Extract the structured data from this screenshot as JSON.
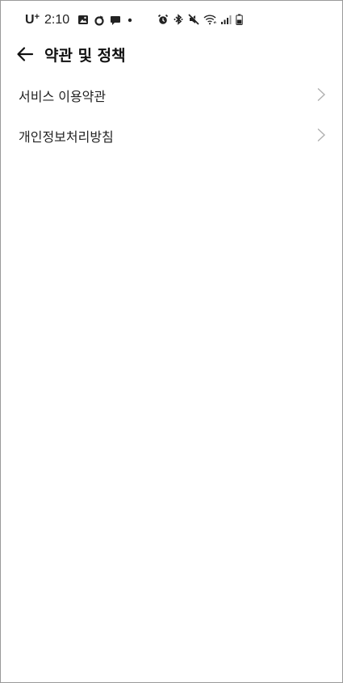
{
  "status_bar": {
    "carrier": "U",
    "carrier_sup": "+",
    "time": "2:10",
    "left_icons": [
      "gallery-icon",
      "sync-icon",
      "chat-icon",
      "dot-icon"
    ],
    "right_icons": [
      "alarm-icon",
      "bluetooth-icon",
      "mute-icon",
      "wifi-icon",
      "signal-icon",
      "battery-icon"
    ]
  },
  "header": {
    "title": "약관 및 정책",
    "back_icon": "arrow-left-icon"
  },
  "menu": {
    "items": [
      {
        "label": "서비스 이용약관",
        "icon": "chevron-right-icon"
      },
      {
        "label": "개인정보처리방침",
        "icon": "chevron-right-icon"
      }
    ]
  },
  "colors": {
    "background": "#ffffff",
    "text": "#222222",
    "chevron": "#b0b0b0",
    "frame_border": "#9a9a9a"
  }
}
